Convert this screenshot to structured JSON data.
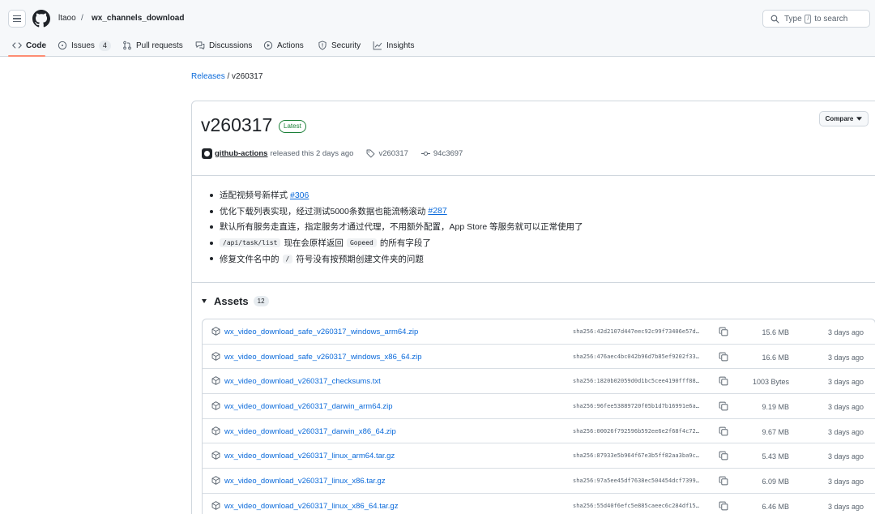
{
  "header": {
    "owner": "ltaoo",
    "separator": "/",
    "repo": "wx_channels_download",
    "search": {
      "prefix": "Type",
      "key": "/",
      "suffix": "to search"
    }
  },
  "tabs": [
    {
      "label": "Code",
      "icon": "code-icon",
      "active": true
    },
    {
      "label": "Issues",
      "icon": "issue-icon",
      "count": "4"
    },
    {
      "label": "Pull requests",
      "icon": "pull-request-icon"
    },
    {
      "label": "Discussions",
      "icon": "discussions-icon"
    },
    {
      "label": "Actions",
      "icon": "play-icon"
    },
    {
      "label": "Security",
      "icon": "shield-icon"
    },
    {
      "label": "Insights",
      "icon": "graph-icon"
    }
  ],
  "breadcrumb": {
    "releases": "Releases",
    "separator": "/",
    "current": "v260317"
  },
  "release": {
    "title": "v260317",
    "badge": "Latest",
    "compare_label": "Compare",
    "author": "github-actions",
    "released_text": "released this 2 days ago",
    "tag": "v260317",
    "commit": "94c3697",
    "notes": [
      {
        "text": "适配视频号新样式",
        "link": "#306"
      },
      {
        "text": "优化下载列表实现，经过测试5000条数据也能流畅滚动",
        "link": "#287"
      },
      {
        "text": "默认所有服务走直连，指定服务才通过代理，不用额外配置，App Store 等服务就可以正常使用了"
      },
      {
        "code1": "/api/task/list",
        "mid": "现在会原样返回",
        "code2": "Gopeed",
        "tail": "的所有字段了"
      },
      {
        "pre": "修复文件名中的",
        "code1": "/",
        "tail": "符号没有按预期创建文件夹的问题"
      }
    ]
  },
  "assets": {
    "title": "Assets",
    "count": "12",
    "items": [
      {
        "name": "wx_video_download_safe_v260317_windows_arm64.zip",
        "sha": "sha256:42d2107d447eec92c99f73406e57d…",
        "size": "15.6 MB",
        "date": "3 days ago"
      },
      {
        "name": "wx_video_download_safe_v260317_windows_x86_64.zip",
        "sha": "sha256:476aec4bc042b96d7b85ef9202f33…",
        "size": "16.6 MB",
        "date": "3 days ago"
      },
      {
        "name": "wx_video_download_v260317_checksums.txt",
        "sha": "sha256:1820b02059d0d1bc5cee4190fff88…",
        "size": "1003 Bytes",
        "date": "3 days ago"
      },
      {
        "name": "wx_video_download_v260317_darwin_arm64.zip",
        "sha": "sha256:96fee53889720f05b1d7b16991e6a…",
        "size": "9.19 MB",
        "date": "3 days ago"
      },
      {
        "name": "wx_video_download_v260317_darwin_x86_64.zip",
        "sha": "sha256:00026f792596b592ee6e2f68f4c72…",
        "size": "9.67 MB",
        "date": "3 days ago"
      },
      {
        "name": "wx_video_download_v260317_linux_arm64.tar.gz",
        "sha": "sha256:87933e5b964f67e3b5ff82aa3ba9c…",
        "size": "5.43 MB",
        "date": "3 days ago"
      },
      {
        "name": "wx_video_download_v260317_linux_x86.tar.gz",
        "sha": "sha256:97a5ee45df7638ec504454dcf7399…",
        "size": "6.09 MB",
        "date": "3 days ago"
      },
      {
        "name": "wx_video_download_v260317_linux_x86_64.tar.gz",
        "sha": "sha256:55d40f6efc5e885caeec6c284df15…",
        "size": "6.46 MB",
        "date": "3 days ago"
      }
    ]
  },
  "colors": {
    "link": "#0969da",
    "accent_underline": "#fd8c73",
    "latest_green": "#1a7f37"
  }
}
